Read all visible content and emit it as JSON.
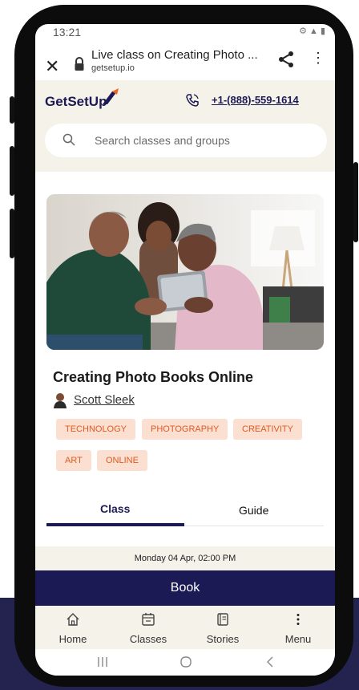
{
  "status_bar": {
    "time": "13:21",
    "icons": "⚙ ▲ ▮"
  },
  "browser": {
    "page_title": "Live class on Creating Photo ...",
    "domain": "getsetup.io"
  },
  "site": {
    "logo_text": "GetSetUp",
    "phone_number": "+1-(888)-559-1614",
    "search_placeholder": "Search classes and groups"
  },
  "class": {
    "title": "Creating Photo Books Online",
    "instructor": "Scott Sleek",
    "tags": [
      "TECHNOLOGY",
      "PHOTOGRAPHY",
      "CREATIVITY",
      "ART",
      "ONLINE"
    ]
  },
  "tabs": [
    {
      "label": "Class",
      "active": true
    },
    {
      "label": "Guide",
      "active": false
    }
  ],
  "schedule": {
    "date_time": "Monday 04 Apr, 02:00 PM"
  },
  "book_button": {
    "label": "Book"
  },
  "bottom_nav": [
    {
      "label": "Home",
      "icon": "home-icon"
    },
    {
      "label": "Classes",
      "icon": "calendar-icon"
    },
    {
      "label": "Stories",
      "icon": "book-icon"
    },
    {
      "label": "Menu",
      "icon": "more-vertical-icon"
    }
  ],
  "colors": {
    "brand_navy": "#1c1a55",
    "cream": "#f5f2ea",
    "tag_bg": "#fbe0d2",
    "tag_text": "#e05a20",
    "logo_accent": "#f26522"
  }
}
